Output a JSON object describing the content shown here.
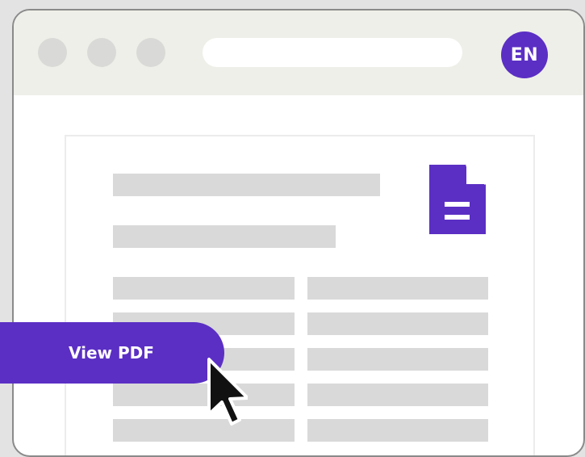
{
  "user": {
    "initials": "EN"
  },
  "document": {
    "action_label": "View PDF"
  },
  "icons": {
    "file": "file-document-icon",
    "cursor": "mouse-pointer-icon"
  },
  "colors": {
    "accent": "#5b2fc4",
    "titlebar": "#efefe9",
    "placeholder": "#d9d9d9"
  }
}
